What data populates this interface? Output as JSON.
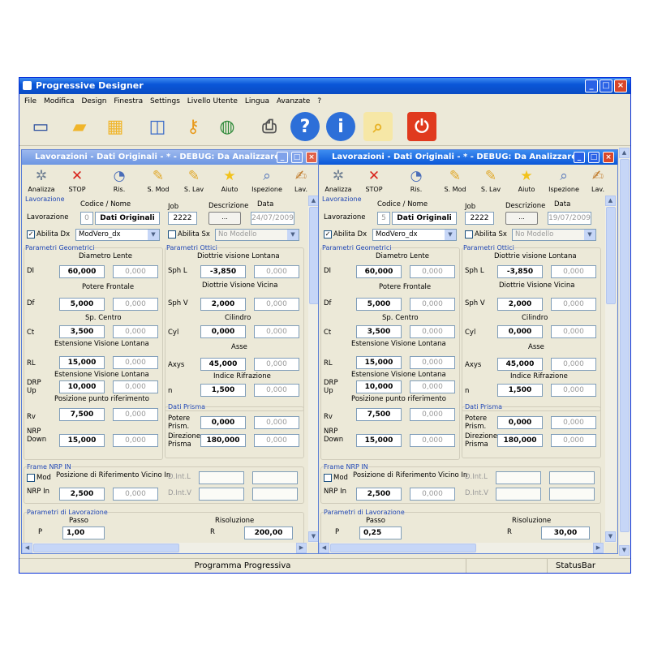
{
  "app": {
    "title": "Progressive Designer",
    "status_main": "Programma Progressiva",
    "status_bar": "StatusBar"
  },
  "menu": [
    "File",
    "Modifica",
    "Design",
    "Finestra",
    "Settings",
    "Livello Utente",
    "Lingua",
    "Avanzate",
    "?"
  ],
  "tools": [
    {
      "name": "window-icon"
    },
    {
      "name": "folder-icon"
    },
    {
      "name": "folder-calendar-icon"
    },
    {
      "name": "dashboard-icon"
    },
    {
      "name": "key-icon"
    },
    {
      "name": "globe-icon"
    },
    {
      "name": "printer-icon"
    },
    {
      "name": "help-icon"
    },
    {
      "name": "info-icon"
    },
    {
      "name": "search-folder-icon"
    },
    {
      "name": "power-icon"
    }
  ],
  "child_toolbar": [
    "Analizza",
    "STOP",
    "Ris.",
    "S. Mod",
    "S. Lav",
    "Aiuto",
    "Ispezione",
    "Lav."
  ],
  "labels": {
    "lavorazione": "Lavorazione",
    "codice_nome": "Codice / Nome",
    "job": "Job",
    "descrizione": "Descrizione",
    "data": "Data",
    "abilita_dx": "Abilita Dx",
    "abilita_sx": "Abilita Sx",
    "no_modello": "No Modello",
    "param_geo": "Parametri Geometrici",
    "param_ott": "Parametri Ottici",
    "diametro": "Diametro Lente",
    "potere_frontale": "Potere Frontale",
    "sp_centro": "Sp. Centro",
    "est_lontana": "Estensione Visione Lontana",
    "est_lontana2": "Estensione Visione Lontana",
    "pos_punto": "Posizione punto riferimento",
    "diottrie_lontana": "Diottrie visione Lontana",
    "diottrie_vicina": "Diottrie Visione Vicina",
    "cilindro": "Cilindro",
    "asse": "Asse",
    "indice": "Indice Rifrazione",
    "dati_prisma": "Dati Prisma",
    "di": "DI",
    "df": "Df",
    "ct": "Ct",
    "rl": "RL",
    "drp": "DRP",
    "up": "Up",
    "rv": "Rv",
    "nrp": "NRP",
    "down": "Down",
    "sphl": "Sph L",
    "sphv": "Sph V",
    "cyl": "Cyl",
    "axys": "Axys",
    "n": "n",
    "potere": "Potere",
    "prism": "Prism.",
    "direzione": "Direzione",
    "prisma": "Prisma",
    "frame_nrp": "Frame NRP  IN",
    "mod": "Mod",
    "pos_rif_vicino": "Posizione di Riferimento Vicino In",
    "nrp_in": "NRP In",
    "dintl": "D.Int.L",
    "dintv": "D.Int.V",
    "param_lav": "Parametri di Lavorazione",
    "passo": "Passo",
    "risoluzione": "Risoluzione",
    "p": "P",
    "r": "R",
    "desc_btn": "..."
  },
  "windows": [
    {
      "title": "Lavorazioni - Dati Originali - * - DEBUG: Da Analizzare",
      "code": "0",
      "name": "Dati Originali",
      "job": "2222",
      "date": "24/07/2009",
      "model": "ModVero_dx",
      "di": "60,000",
      "df": "5,000",
      "ct": "3,500",
      "rl": "15,000",
      "drp": "10,000",
      "rv": "7,500",
      "nrp": "15,000",
      "sphl": "-3,850",
      "sphv": "2,000",
      "cyl": "0,000",
      "axys": "45,000",
      "n": "1,500",
      "prism": "0,000",
      "dir": "180,000",
      "zero": "0,000",
      "nrp_in": "2,500",
      "passo": "1,00",
      "ris": "200,00"
    },
    {
      "title": "Lavorazioni - Dati Originali - * - DEBUG: Da Analizzare",
      "code": "5",
      "name": "Dati Originali",
      "job": "2222",
      "date": "19/07/2009",
      "model": "ModVero_dx",
      "di": "60,000",
      "df": "5,000",
      "ct": "3,500",
      "rl": "15,000",
      "drp": "10,000",
      "rv": "7,500",
      "nrp": "15,000",
      "sphl": "-3,850",
      "sphv": "2,000",
      "cyl": "0,000",
      "axys": "45,000",
      "n": "1,500",
      "prism": "0,000",
      "dir": "180,000",
      "zero": "0,000",
      "nrp_in": "2,500",
      "passo": "0,25",
      "ris": "30,00"
    }
  ],
  "colors": {
    "titlebar": "#0a56d8",
    "window_bg": "#ece9d8",
    "group_label": "#1f46b5"
  }
}
